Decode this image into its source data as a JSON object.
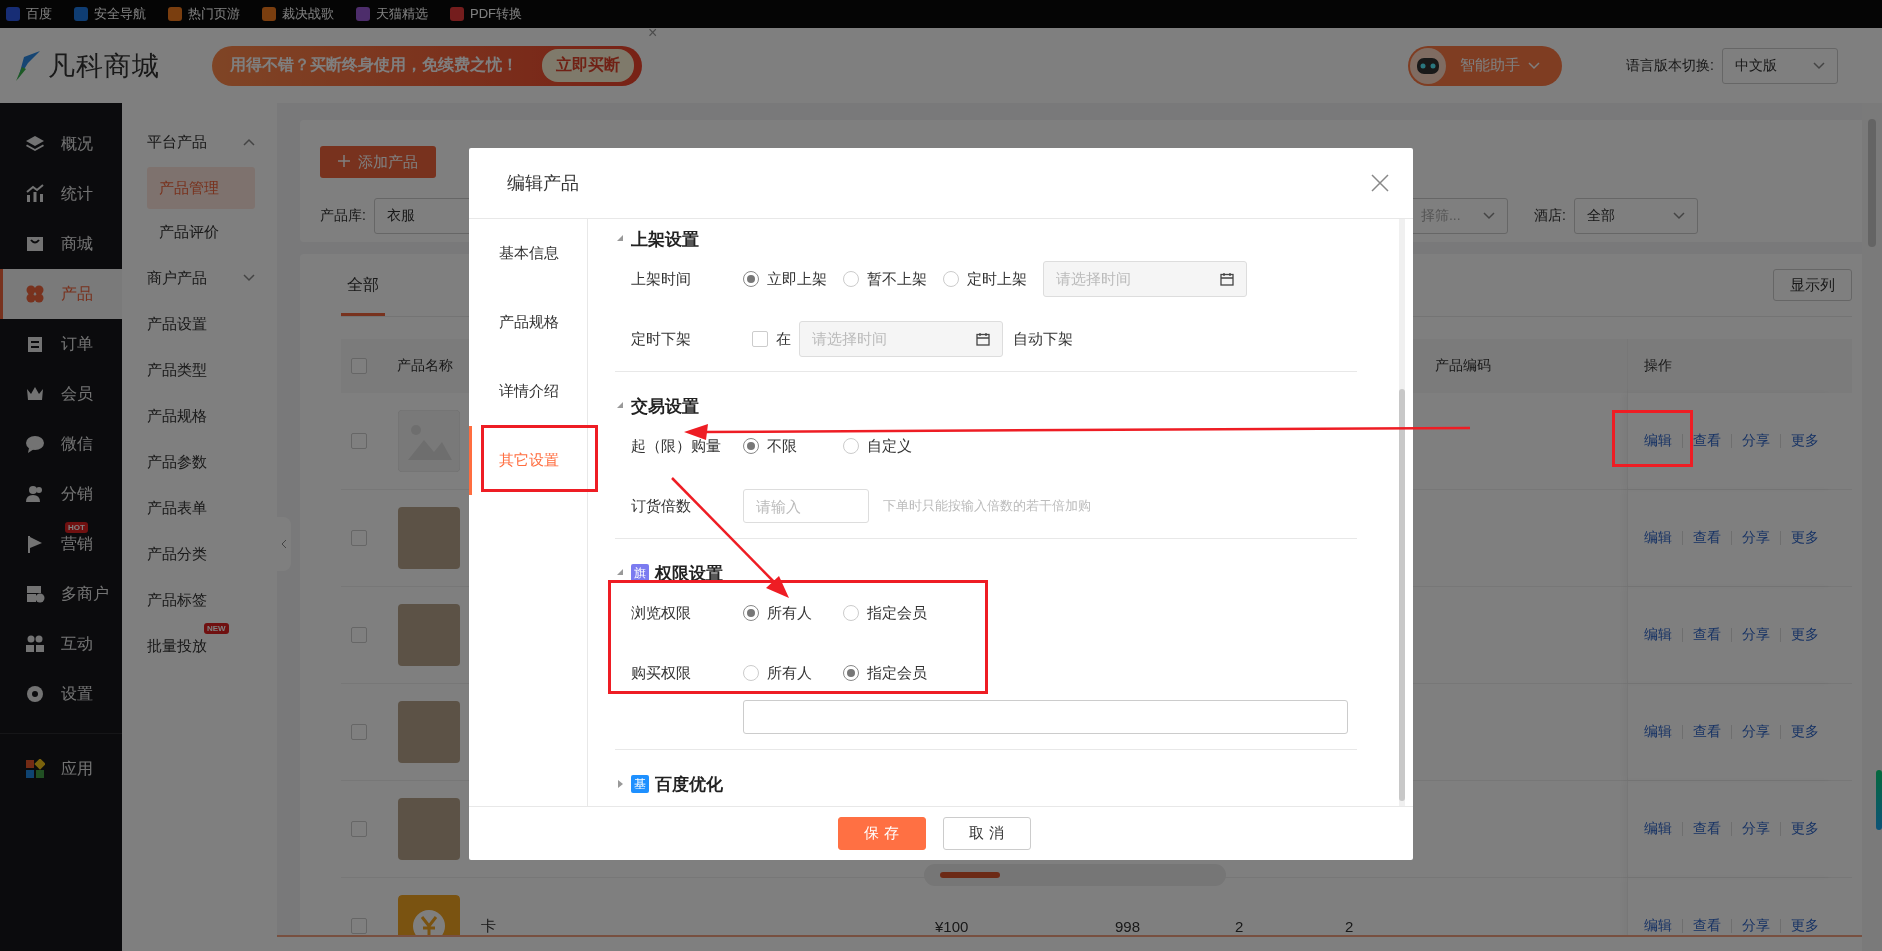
{
  "bookmarks": [
    {
      "label": "百度"
    },
    {
      "label": "安全导航"
    },
    {
      "label": "热门页游"
    },
    {
      "label": "裁决战歌"
    },
    {
      "label": "天猫精选"
    },
    {
      "label": "PDF转换"
    }
  ],
  "header": {
    "logo": "凡科商城",
    "promo": {
      "text": "用得不错？买断终身使用，免续费之忧！",
      "button": "立即买断",
      "close": "×"
    },
    "assistant": "智能助手",
    "language": {
      "label": "语言版本切换:",
      "value": "中文版"
    }
  },
  "sidebar": {
    "items": [
      {
        "label": "概况",
        "selected": false
      },
      {
        "label": "统计",
        "selected": false
      },
      {
        "label": "商城",
        "selected": false
      },
      {
        "label": "产品",
        "selected": true
      },
      {
        "label": "订单",
        "selected": false
      },
      {
        "label": "会员",
        "selected": false
      },
      {
        "label": "微信",
        "selected": false
      },
      {
        "label": "分销",
        "selected": false
      },
      {
        "label": "营销",
        "selected": false,
        "badge": "HOT"
      },
      {
        "label": "多商户",
        "selected": false
      },
      {
        "label": "互动",
        "selected": false
      },
      {
        "label": "设置",
        "selected": false
      }
    ],
    "apps": {
      "label": "应用",
      "selected": false
    }
  },
  "submenu": {
    "items": [
      {
        "label": "平台产品",
        "selected": false,
        "expanded": true,
        "children": [
          {
            "label": "产品管理",
            "selected": true
          },
          {
            "label": "产品评价",
            "selected": false
          }
        ]
      },
      {
        "label": "商户产品",
        "selected": false,
        "expanded": false
      },
      {
        "label": "产品设置",
        "selected": false
      },
      {
        "label": "产品类型",
        "selected": false
      },
      {
        "label": "产品规格",
        "selected": false
      },
      {
        "label": "产品参数",
        "selected": false
      },
      {
        "label": "产品表单",
        "selected": false
      },
      {
        "label": "产品分类",
        "selected": false
      },
      {
        "label": "产品标签",
        "selected": false
      },
      {
        "label": "批量投放",
        "selected": false,
        "badge": "NEW"
      }
    ]
  },
  "toolbar": {
    "add_button": "添加产品",
    "library": {
      "label": "产品库:",
      "value": "衣服"
    },
    "filter": {
      "placeholder": "择筛..."
    },
    "hotel": {
      "label": "酒店:",
      "value": "全部"
    }
  },
  "tabs": [
    {
      "label": "全部",
      "selected": true
    }
  ],
  "columns_button": "显示列",
  "table": {
    "header": {
      "name": "产品名称",
      "code": "产品编码",
      "actions": "操作"
    },
    "header_checked": false,
    "rows": [
      {
        "kind": "placeholder",
        "checked": false,
        "actions": [
          "编辑",
          "查看",
          "分享",
          "更多"
        ]
      },
      {
        "kind": "photo",
        "checked": false,
        "actions": [
          "编辑",
          "查看",
          "分享",
          "更多"
        ]
      },
      {
        "kind": "photo",
        "checked": false,
        "actions": [
          "编辑",
          "查看",
          "分享",
          "更多"
        ]
      },
      {
        "kind": "photo",
        "checked": false,
        "actions": [
          "编辑",
          "查看",
          "分享",
          "更多"
        ]
      },
      {
        "kind": "photo",
        "checked": false,
        "actions": [
          "编辑",
          "查看",
          "分享",
          "更多"
        ]
      },
      {
        "kind": "coin",
        "checked": false,
        "name": "卡",
        "cells": [
          "¥100",
          "998",
          "2",
          "2"
        ],
        "actions": [
          "编辑",
          "查看",
          "分享",
          "更多"
        ]
      }
    ]
  },
  "modal": {
    "title": "编辑产品",
    "nav": [
      {
        "label": "基本信息",
        "selected": false
      },
      {
        "label": "产品规格",
        "selected": false
      },
      {
        "label": "详情介绍",
        "selected": false
      },
      {
        "label": "其它设置",
        "selected": true
      }
    ],
    "sections": [
      {
        "title": "上架设置",
        "expanded": true,
        "rows": [
          {
            "kind": "radio",
            "label": "上架时间",
            "options": [
              {
                "label": "立即上架",
                "selected": true
              },
              {
                "label": "暂不上架",
                "selected": false
              },
              {
                "label": "定时上架",
                "selected": false
              }
            ],
            "date": {
              "placeholder": "请选择时间"
            }
          },
          {
            "kind": "checkbox_date",
            "label": "定时下架",
            "checked": false,
            "prefix": "在",
            "date": {
              "placeholder": "请选择时间"
            },
            "suffix": "自动下架"
          }
        ]
      },
      {
        "title": "交易设置",
        "expanded": true,
        "rows": [
          {
            "kind": "radio",
            "label": "起（限）购量",
            "options": [
              {
                "label": "不限",
                "selected": true
              },
              {
                "label": "自定义",
                "selected": false
              }
            ]
          },
          {
            "kind": "input",
            "label": "订货倍数",
            "placeholder": "请输入",
            "hint": "下单时只能按输入倍数的若干倍加购"
          }
        ]
      },
      {
        "title": "权限设置",
        "badge": "旗",
        "color": "#7b7bf0",
        "expanded": true,
        "rows": [
          {
            "kind": "radio",
            "label": "浏览权限",
            "options": [
              {
                "label": "所有人",
                "selected": true
              },
              {
                "label": "指定会员",
                "selected": false
              }
            ]
          },
          {
            "kind": "radio",
            "label": "购买权限",
            "options": [
              {
                "label": "所有人",
                "selected": false
              },
              {
                "label": "指定会员",
                "selected": true
              }
            ]
          },
          {
            "kind": "field"
          }
        ]
      },
      {
        "title": "百度优化",
        "badge": "基",
        "color": "#1e90ff",
        "expanded": false
      }
    ],
    "buttons": [
      {
        "label": "保 存",
        "kind": "primary"
      },
      {
        "label": "取 消",
        "kind": "default"
      }
    ]
  }
}
